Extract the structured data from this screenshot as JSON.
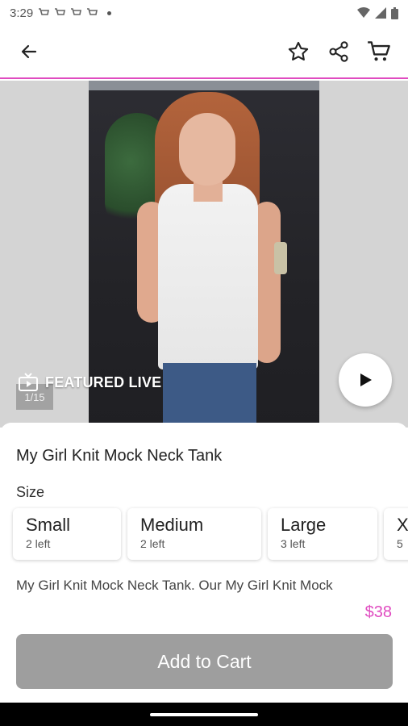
{
  "status": {
    "time": "3:29"
  },
  "product": {
    "title": "My Girl Knit Mock Neck Tank",
    "size_label": "Size",
    "sizes": [
      {
        "name": "Small",
        "left": "2 left"
      },
      {
        "name": "Medium",
        "left": "2 left"
      },
      {
        "name": "Large",
        "left": "3 left"
      },
      {
        "name": "X",
        "left": "5"
      }
    ],
    "description": "My Girl Knit Mock Neck Tank. Our My Girl Knit Mock",
    "price": "$38",
    "add_to_cart": "Add to Cart"
  },
  "media": {
    "featured_label": "FEATURED LIVE",
    "counter": "1/15"
  },
  "colors": {
    "accent": "#e04bc0",
    "button_disabled": "#9e9e9e"
  },
  "icons": [
    "back-arrow-icon",
    "star-icon",
    "share-icon",
    "cart-icon",
    "tv-icon",
    "play-icon"
  ]
}
